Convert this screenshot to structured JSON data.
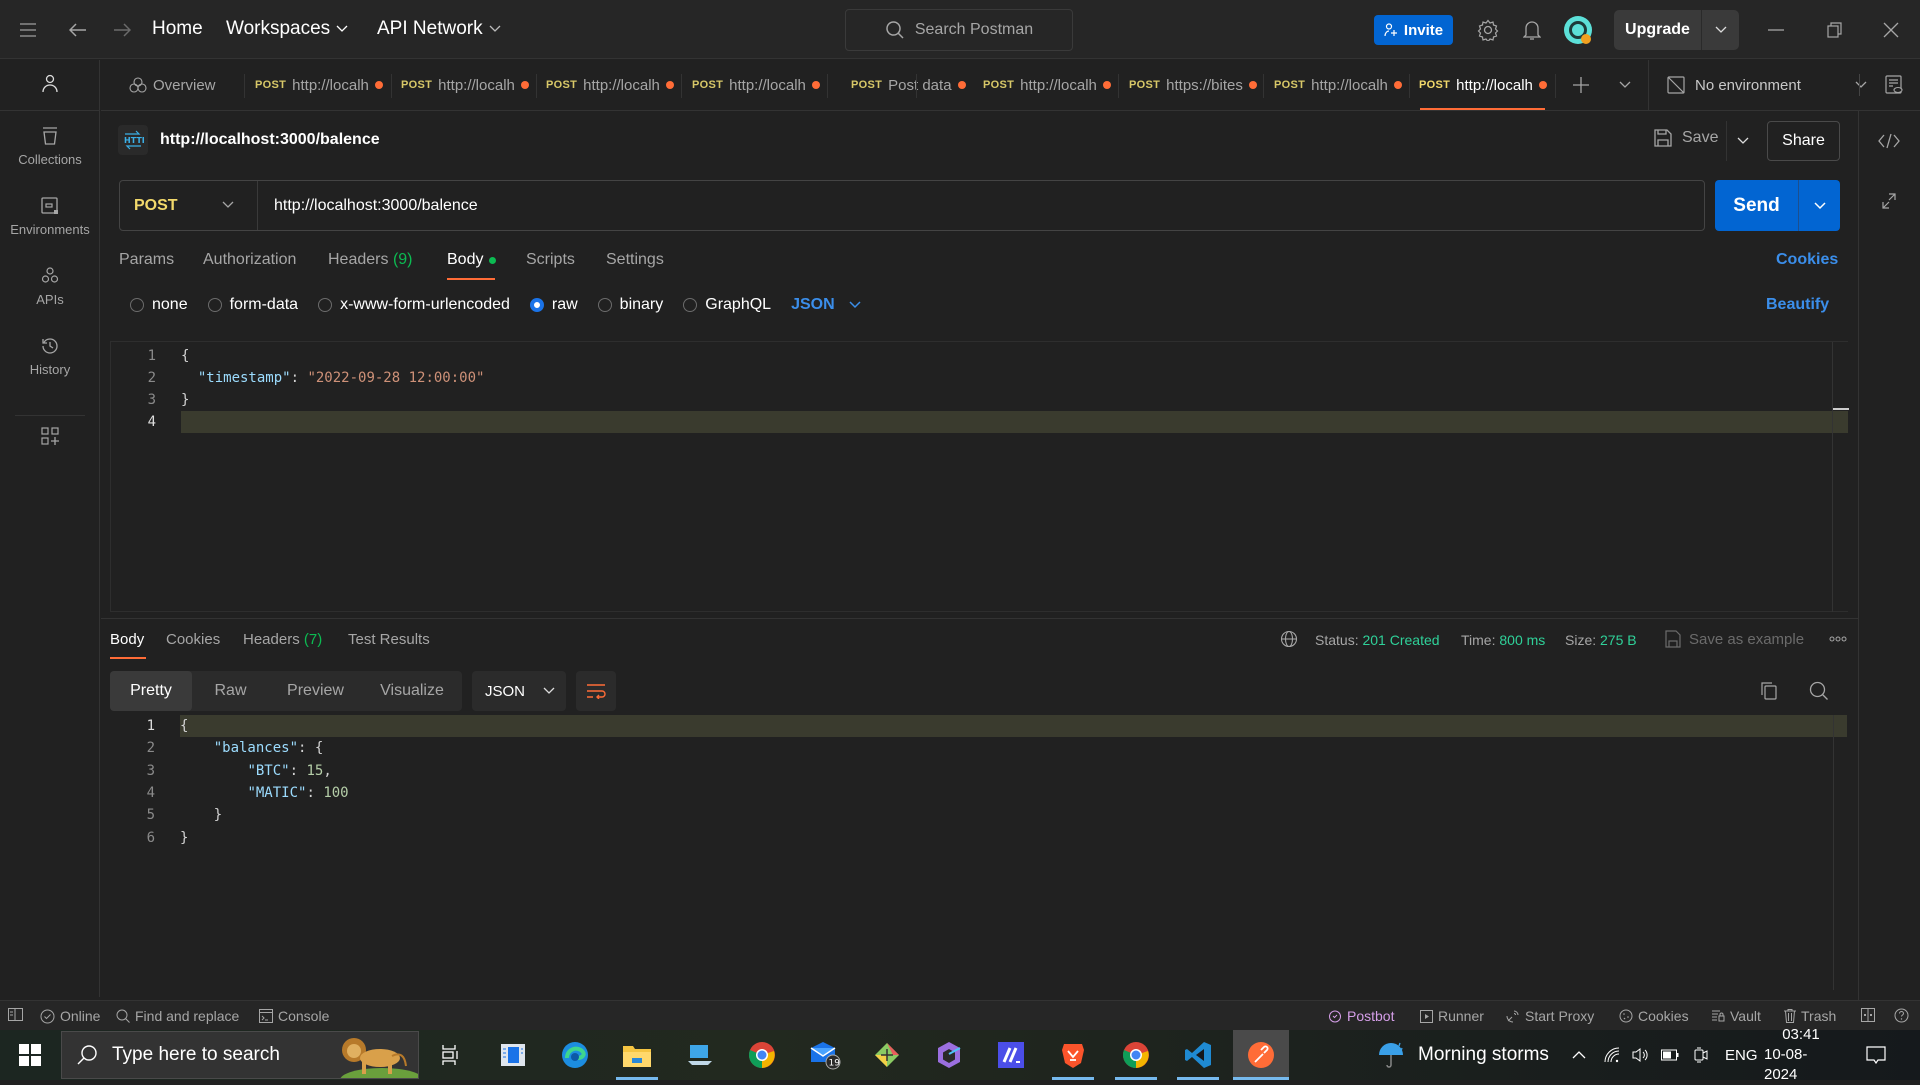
{
  "topbar": {
    "nav": {
      "home": "Home",
      "workspaces": "Workspaces",
      "api_network": "API Network"
    },
    "search_placeholder": "Search Postman",
    "invite_label": "Invite",
    "upgrade_label": "Upgrade"
  },
  "sidebar": {
    "items": [
      {
        "label": "Collections",
        "icon": "collections-icon"
      },
      {
        "label": "Environments",
        "icon": "environments-icon"
      },
      {
        "label": "APIs",
        "icon": "apis-icon"
      },
      {
        "label": "History",
        "icon": "history-icon"
      }
    ]
  },
  "tabs": {
    "overview_label": "Overview",
    "items": [
      {
        "method": "POST",
        "title": "http://localh",
        "unsaved": true
      },
      {
        "method": "POST",
        "title": "http://localh",
        "unsaved": true
      },
      {
        "method": "POST",
        "title": "http://localh",
        "unsaved": true
      },
      {
        "method": "POST",
        "title": "http://localh",
        "unsaved": true
      },
      {
        "method": "POST",
        "title": "Post data",
        "unsaved": true
      },
      {
        "method": "POST",
        "title": "http://localh",
        "unsaved": true
      },
      {
        "method": "POST",
        "title": "https://bites",
        "unsaved": true
      },
      {
        "method": "POST",
        "title": "http://localh",
        "unsaved": true
      },
      {
        "method": "POST",
        "title": "http://localh",
        "unsaved": true,
        "active": true
      }
    ],
    "environment": "No environment"
  },
  "request": {
    "title": "http://localhost:3000/balence",
    "save_label": "Save",
    "share_label": "Share",
    "method": "POST",
    "url": "http://localhost:3000/balence",
    "send_label": "Send",
    "tabs": [
      "Params",
      "Authorization",
      "Headers",
      "Body",
      "Scripts",
      "Settings"
    ],
    "headers_count": "(9)",
    "active_tab": "Body",
    "cookies_label": "Cookies",
    "body_types": [
      "none",
      "form-data",
      "x-www-form-urlencoded",
      "raw",
      "binary",
      "GraphQL"
    ],
    "selected_body_type": "raw",
    "body_format": "JSON",
    "beautify_label": "Beautify",
    "body_lines": [
      "{",
      "  \"timestamp\": \"2022-09-28 12:00:00\"",
      "}",
      ""
    ]
  },
  "response": {
    "tabs": [
      "Body",
      "Cookies",
      "Headers",
      "Test Results"
    ],
    "headers_count": "(7)",
    "status_label": "Status:",
    "status_value": "201 Created",
    "time_label": "Time:",
    "time_value": "800 ms",
    "size_label": "Size:",
    "size_value": "275 B",
    "save_example_label": "Save as example",
    "views": [
      "Pretty",
      "Raw",
      "Preview",
      "Visualize"
    ],
    "active_view": "Pretty",
    "format": "JSON",
    "body_lines": [
      "{",
      "    \"balances\": {",
      "        \"BTC\": 15,",
      "        \"MATIC\": 100",
      "    }",
      "}"
    ]
  },
  "statusbar": {
    "online": "Online",
    "find_replace": "Find and replace",
    "console": "Console",
    "postbot": "Postbot",
    "runner": "Runner",
    "start_proxy": "Start Proxy",
    "cookies": "Cookies",
    "vault": "Vault",
    "trash": "Trash"
  },
  "taskbar": {
    "search_placeholder": "Type here to search",
    "mail_badge": "19",
    "weather": "Morning storms",
    "language": "ENG",
    "time": "03:41",
    "date": "10-08-2024"
  },
  "colors": {
    "accent": "#ff6c37",
    "primary_blue": "#0265d2",
    "method_post": "#f2d96b",
    "success": "#2fd199"
  }
}
